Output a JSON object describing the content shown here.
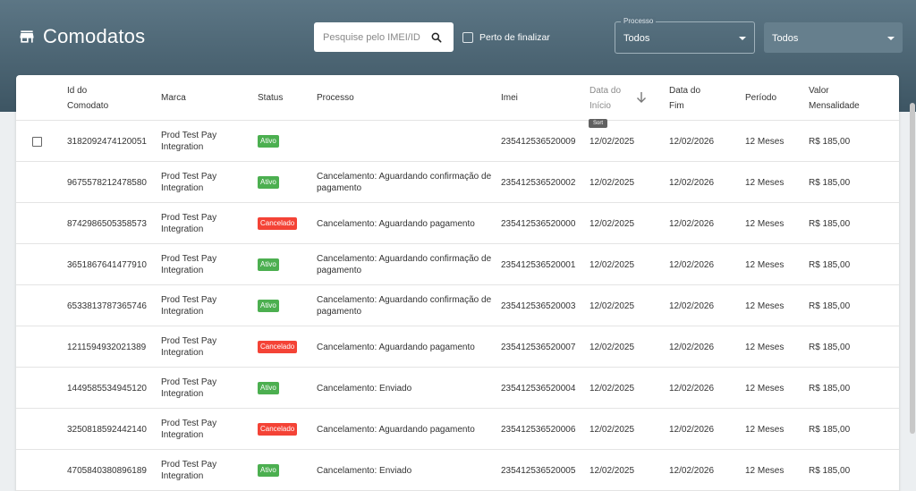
{
  "header": {
    "title": "Comodatos",
    "search_placeholder": "Pesquise pelo IMEI/ID",
    "near_finish_label": "Perto de finalizar",
    "process_filter": {
      "legend": "Processo",
      "value": "Todos"
    },
    "second_filter": {
      "value": "Todos"
    }
  },
  "table": {
    "columns": {
      "id": [
        "Id do",
        "Comodato"
      ],
      "brand": "Marca",
      "status": "Status",
      "process": "Processo",
      "imei": "Imei",
      "start": [
        "Data do",
        "Início"
      ],
      "end": [
        "Data do",
        "Fim"
      ],
      "period": "Período",
      "fee": [
        "Valor",
        "Mensalidade"
      ]
    },
    "sort_tooltip": "Sort",
    "rows": [
      {
        "id": "3182092474120051",
        "brand": [
          "Prod Test Pay",
          "Integration"
        ],
        "status": "Ativo",
        "status_type": "ativo",
        "process": [
          "",
          ""
        ],
        "imei": "235412536520009",
        "start": "12/02/2025",
        "end": "12/02/2026",
        "period": "12 Meses",
        "fee": "R$ 185,00"
      },
      {
        "id": "9675578212478580",
        "brand": [
          "Prod Test Pay",
          "Integration"
        ],
        "status": "Ativo",
        "status_type": "ativo",
        "process": [
          "Cancelamento: Aguardando confirmação de",
          "pagamento"
        ],
        "imei": "235412536520002",
        "start": "12/02/2025",
        "end": "12/02/2026",
        "period": "12 Meses",
        "fee": "R$ 185,00"
      },
      {
        "id": "8742986505358573",
        "brand": [
          "Prod Test Pay",
          "Integration"
        ],
        "status": "Cancelado",
        "status_type": "cancelado",
        "process": [
          "Cancelamento: Aguardando pagamento",
          ""
        ],
        "imei": "235412536520000",
        "start": "12/02/2025",
        "end": "12/02/2026",
        "period": "12 Meses",
        "fee": "R$ 185,00"
      },
      {
        "id": "3651867641477910",
        "brand": [
          "Prod Test Pay",
          "Integration"
        ],
        "status": "Ativo",
        "status_type": "ativo",
        "process": [
          "Cancelamento: Aguardando confirmação de",
          "pagamento"
        ],
        "imei": "235412536520001",
        "start": "12/02/2025",
        "end": "12/02/2026",
        "period": "12 Meses",
        "fee": "R$ 185,00"
      },
      {
        "id": "6533813787365746",
        "brand": [
          "Prod Test Pay",
          "Integration"
        ],
        "status": "Ativo",
        "status_type": "ativo",
        "process": [
          "Cancelamento: Aguardando confirmação de",
          "pagamento"
        ],
        "imei": "235412536520003",
        "start": "12/02/2025",
        "end": "12/02/2026",
        "period": "12 Meses",
        "fee": "R$ 185,00"
      },
      {
        "id": "1211594932021389",
        "brand": [
          "Prod Test Pay",
          "Integration"
        ],
        "status": "Cancelado",
        "status_type": "cancelado",
        "process": [
          "Cancelamento: Aguardando pagamento",
          ""
        ],
        "imei": "235412536520007",
        "start": "12/02/2025",
        "end": "12/02/2026",
        "period": "12 Meses",
        "fee": "R$ 185,00"
      },
      {
        "id": "1449585534945120",
        "brand": [
          "Prod Test Pay",
          "Integration"
        ],
        "status": "Ativo",
        "status_type": "ativo",
        "process": [
          "Cancelamento: Enviado",
          ""
        ],
        "imei": "235412536520004",
        "start": "12/02/2025",
        "end": "12/02/2026",
        "period": "12 Meses",
        "fee": "R$ 185,00"
      },
      {
        "id": "3250818592442140",
        "brand": [
          "Prod Test Pay",
          "Integration"
        ],
        "status": "Cancelado",
        "status_type": "cancelado",
        "process": [
          "Cancelamento: Aguardando pagamento",
          ""
        ],
        "imei": "235412536520006",
        "start": "12/02/2025",
        "end": "12/02/2026",
        "period": "12 Meses",
        "fee": "R$ 185,00"
      },
      {
        "id": "4705840380896189",
        "brand": [
          "Prod Test Pay",
          "Integration"
        ],
        "status": "Ativo",
        "status_type": "ativo",
        "process": [
          "Cancelamento: Enviado",
          ""
        ],
        "imei": "235412536520005",
        "start": "12/02/2025",
        "end": "12/02/2026",
        "period": "12 Meses",
        "fee": "R$ 185,00"
      }
    ]
  },
  "colors": {
    "header_top": "#5c7685",
    "header_bottom": "#3d5563",
    "ativo": "#4caf50",
    "cancelado": "#f44336"
  }
}
